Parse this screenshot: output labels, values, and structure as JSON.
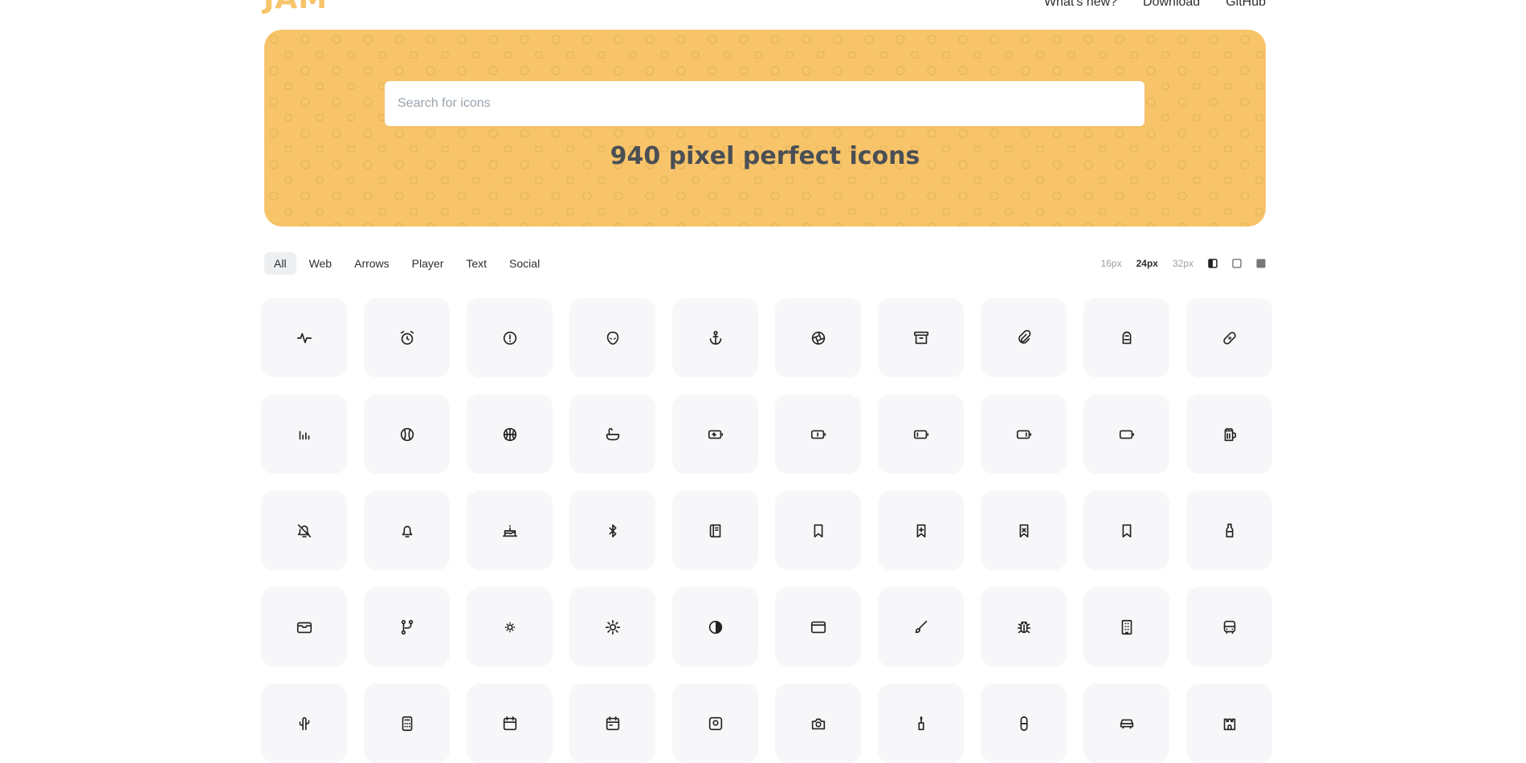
{
  "brand": {
    "logo": "JAM",
    "color": "#f7c46a"
  },
  "nav": [
    "What's new?",
    "Download",
    "GitHub"
  ],
  "hero": {
    "search_placeholder": "Search for icons",
    "title": "940 pixel perfect icons",
    "bg_color": "#f7c46a"
  },
  "categories": [
    {
      "label": "All",
      "active": true
    },
    {
      "label": "Web",
      "active": false
    },
    {
      "label": "Arrows",
      "active": false
    },
    {
      "label": "Player",
      "active": false
    },
    {
      "label": "Text",
      "active": false
    },
    {
      "label": "Social",
      "active": false
    }
  ],
  "sizes": [
    {
      "label": "16px",
      "active": false
    },
    {
      "label": "24px",
      "active": true
    },
    {
      "label": "32px",
      "active": false
    }
  ],
  "styles": [
    "half-filled-style-icon",
    "outline-style-icon",
    "filled-style-icon"
  ],
  "icons": [
    "activity-icon",
    "alarm-clock-icon",
    "alert-icon",
    "alien-icon",
    "anchor-icon",
    "aperture-icon",
    "archive-icon",
    "attachment-icon",
    "backpack-icon",
    "bandage-icon",
    "bar-chart-icon",
    "baseball-icon",
    "basketball-icon",
    "bath-icon",
    "battery-charging-icon",
    "battery-half-icon",
    "battery-low-icon",
    "battery-three-quarters-icon",
    "battery-empty-icon",
    "beer-icon",
    "bell-off-icon",
    "bell-icon",
    "birthday-cake-icon",
    "bluetooth-icon",
    "book-icon",
    "bookmark-minus-icon",
    "bookmark-plus-icon",
    "bookmark-remove-icon",
    "bookmark-icon",
    "bottle-icon",
    "box-icon",
    "branch-icon",
    "brightness-low-icon",
    "brightness-high-icon",
    "contrast-icon",
    "browser-icon",
    "brush-icon",
    "bug-icon",
    "building-icon",
    "bus-icon",
    "cactus-icon",
    "calculator-icon",
    "calendar-icon",
    "calendar-alt-icon",
    "camera-icon",
    "camera-alt-icon",
    "candle-icon",
    "capsule-icon",
    "car-icon",
    "castle-icon"
  ]
}
